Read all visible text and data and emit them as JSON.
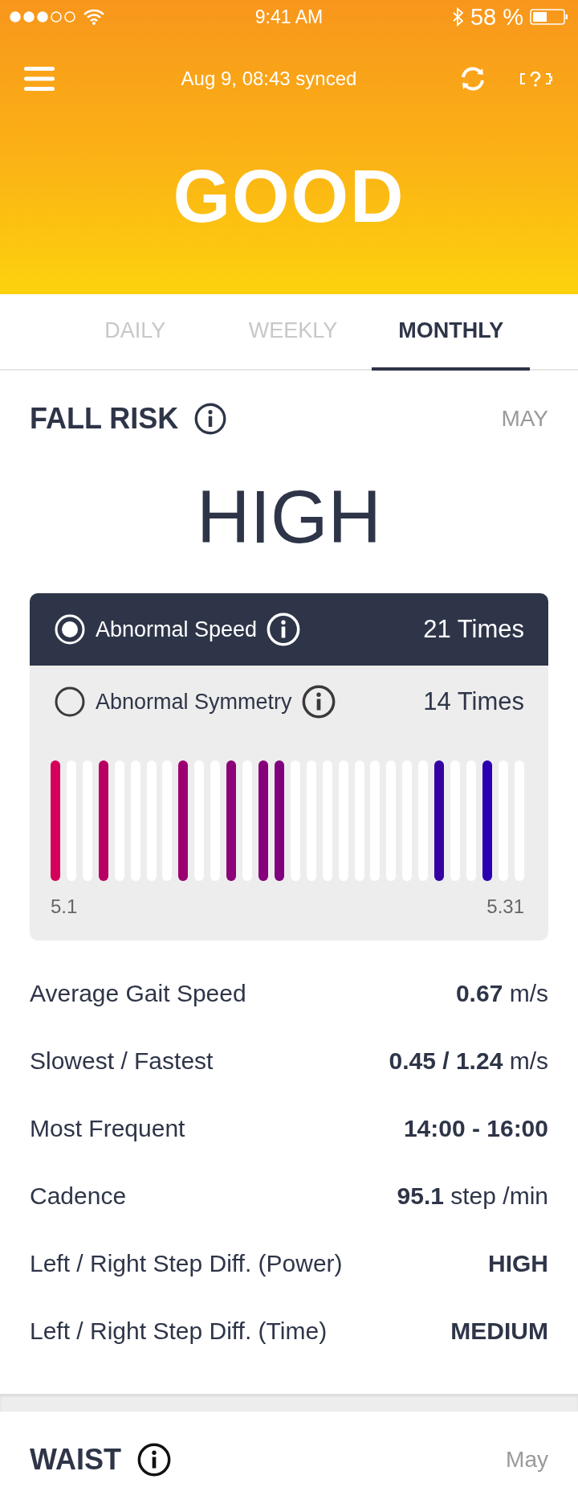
{
  "status_bar": {
    "time": "9:41 AM",
    "battery": "58 %"
  },
  "header": {
    "sync_text": "Aug 9, 08:43 synced",
    "status": "GOOD"
  },
  "tabs": [
    {
      "label": "DAILY",
      "selected": false
    },
    {
      "label": "WEEKLY",
      "selected": false
    },
    {
      "label": "MONTHLY",
      "selected": true
    }
  ],
  "fall_risk": {
    "title": "FALL RISK",
    "period": "MAY",
    "level_text": "HIGH",
    "options": [
      {
        "label": "Abnormal Speed",
        "count": "21",
        "unit": "Times",
        "selected": true
      },
      {
        "label": "Abnormal Symmetry",
        "count": "14",
        "unit": "Times",
        "selected": false
      }
    ],
    "bars": [
      {
        "color": "#d4005a"
      },
      {
        "color": "#ffffff"
      },
      {
        "color": "#ffffff"
      },
      {
        "color": "#b80062"
      },
      {
        "color": "#ffffff"
      },
      {
        "color": "#ffffff"
      },
      {
        "color": "#ffffff"
      },
      {
        "color": "#ffffff"
      },
      {
        "color": "#9c0070"
      },
      {
        "color": "#ffffff"
      },
      {
        "color": "#ffffff"
      },
      {
        "color": "#8c0078"
      },
      {
        "color": "#ffffff"
      },
      {
        "color": "#86007c"
      },
      {
        "color": "#80007e"
      },
      {
        "color": "#ffffff"
      },
      {
        "color": "#ffffff"
      },
      {
        "color": "#ffffff"
      },
      {
        "color": "#ffffff"
      },
      {
        "color": "#ffffff"
      },
      {
        "color": "#ffffff"
      },
      {
        "color": "#ffffff"
      },
      {
        "color": "#ffffff"
      },
      {
        "color": "#ffffff"
      },
      {
        "color": "#3400a2"
      },
      {
        "color": "#ffffff"
      },
      {
        "color": "#ffffff"
      },
      {
        "color": "#2a00b0"
      },
      {
        "color": "#ffffff"
      },
      {
        "color": "#ffffff"
      }
    ],
    "range_start": "5.1",
    "range_end": "5.31",
    "stats": [
      {
        "label": "Average Gait Speed",
        "value": "0.67",
        "unit": "m/s"
      },
      {
        "label": "Slowest / Fastest",
        "value": "0.45 / 1.24",
        "unit": "m/s"
      },
      {
        "label": "Most Frequent",
        "value": "14:00 - 16:00"
      },
      {
        "label": "Cadence",
        "value": "95.1",
        "unit": "step /min"
      },
      {
        "label": "Left / Right Step Diff. (Power)",
        "value": "HIGH"
      },
      {
        "label": "Left / Right Step Diff. (Time)",
        "value": "MEDIUM"
      }
    ]
  },
  "waist": {
    "title": "WAIST",
    "period": "May"
  }
}
